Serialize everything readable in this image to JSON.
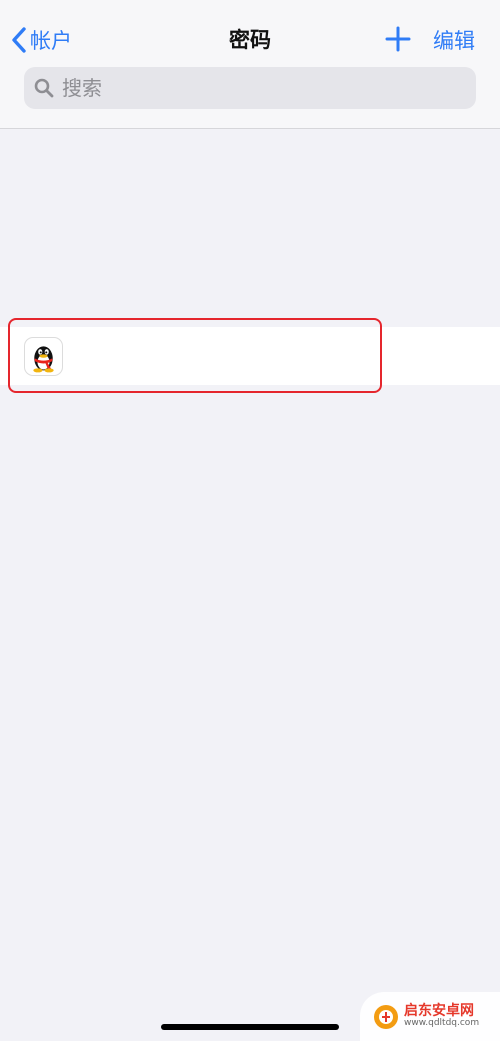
{
  "nav": {
    "back_label": "帐户",
    "title": "密码",
    "add_icon": "plus-icon",
    "edit_label": "编辑"
  },
  "search": {
    "placeholder": "搜索",
    "icon": "magnifier-icon"
  },
  "accounts": [
    {
      "icon": "qq-penguin-icon"
    }
  ],
  "colors": {
    "accent": "#2f7cf6",
    "highlight": "#e5262d",
    "background": "#f2f2f7"
  },
  "watermark": {
    "name": "启东安卓网",
    "url": "www.qdltdq.com"
  }
}
